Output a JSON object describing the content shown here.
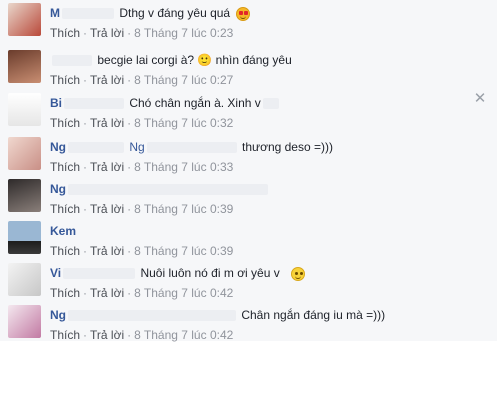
{
  "comments": [
    {
      "name": "M",
      "text": "Dthg v đáng yêu quá",
      "time": "8 Tháng 7 lúc 0:23",
      "emoji": "heart-eyes"
    },
    {
      "name": "",
      "text": "becgie lai corgi à? 🙂 nhìn đáng yêu",
      "time": "8 Tháng 7 lúc 0:27",
      "emoji": "slight-smile"
    },
    {
      "name": "Bi",
      "text": "Chó chân ngắn à. Xinh v",
      "time": "8 Tháng 7 lúc 0:32",
      "emoji": ""
    },
    {
      "name": "Ng",
      "text": "thương deso =)))",
      "time": "8 Tháng 7 lúc 0:33",
      "emoji": ""
    },
    {
      "name": "Ng",
      "text": "",
      "time": "8 Tháng 7 lúc 0:39",
      "emoji": ""
    },
    {
      "name": "Kem",
      "text": "",
      "time": "8 Tháng 7 lúc 0:39",
      "emoji": ""
    },
    {
      "name": "Vi",
      "text": "Nuôi luôn nó đi m ơi yêu v",
      "time": "8 Tháng 7 lúc 0:42",
      "emoji": "smile"
    },
    {
      "name": "Ng",
      "text": "Chân ngắn đáng iu mà =)))",
      "time": "8 Tháng 7 lúc 0:42",
      "emoji": ""
    }
  ],
  "actions": {
    "like": "Thích",
    "reply": "Trả lời",
    "dot": "·"
  },
  "close_label": "✕",
  "colors": {
    "name": "#365899",
    "meta": "#90949c",
    "link": "#4b4f56",
    "panel": "#f6f7f9"
  }
}
